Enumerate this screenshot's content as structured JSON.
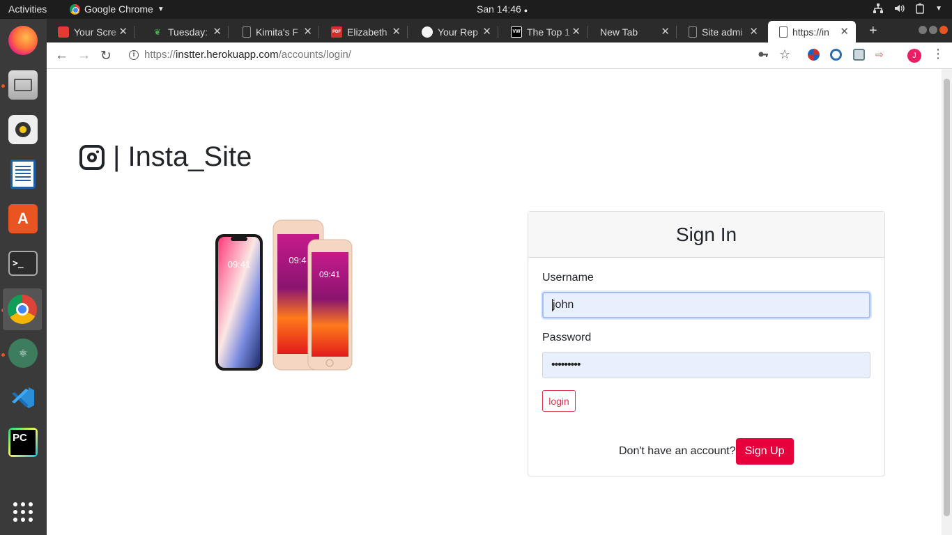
{
  "os": {
    "activities": "Activities",
    "app_name": "Google Chrome",
    "clock": "San 14:46"
  },
  "tabs": [
    {
      "label": "Your Scre",
      "icon": "screencast-icon",
      "color": "#e53935"
    },
    {
      "label": "Tuesday:",
      "icon": "leaf-icon",
      "color": "#4caf50"
    },
    {
      "label": "Kimita's F",
      "icon": "doc-icon",
      "color": "#9e9e9e"
    },
    {
      "label": "Elizabeth",
      "icon": "pdf-icon",
      "color": "#d32f2f"
    },
    {
      "label": "Your Rep",
      "icon": "github-icon",
      "color": "#f5f5f5"
    },
    {
      "label": "The Top 1",
      "icon": "vw-icon",
      "color": "#000000"
    },
    {
      "label": "New Tab",
      "icon": "none",
      "color": ""
    },
    {
      "label": "Site admi",
      "icon": "doc-icon",
      "color": "#9e9e9e"
    },
    {
      "label": "https://in",
      "icon": "doc-icon",
      "color": "#9e9e9e"
    }
  ],
  "url": {
    "scheme": "https://",
    "host": "instter.herokuapp.com",
    "path": "/accounts/login/"
  },
  "profile": {
    "initial": "J",
    "color": "#e91e63"
  },
  "page": {
    "brand": "| Insta_Site",
    "signin_title": "Sign In",
    "username_label": "Username",
    "username_value": "john",
    "password_label": "Password",
    "password_value": "•••••••••",
    "login_label": "login",
    "no_account_text": "Don't have an account?",
    "signup_label": "Sign Up",
    "accent": "#e8003c"
  }
}
